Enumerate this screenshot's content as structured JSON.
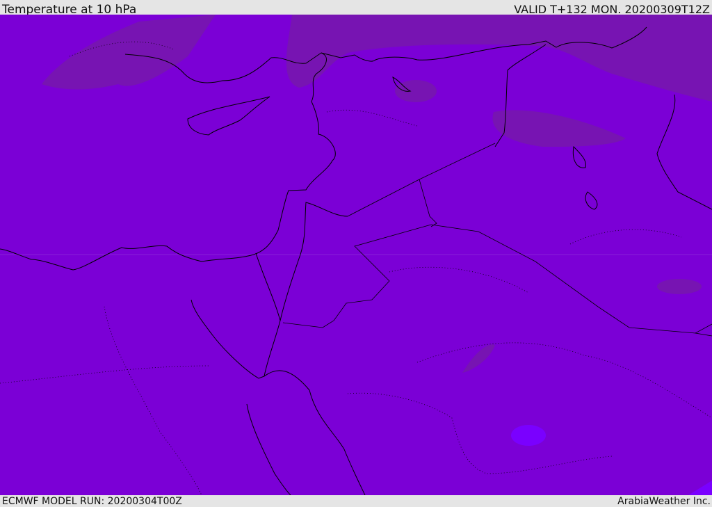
{
  "header": {
    "title": "Temperature at 10 hPa",
    "valid_time": "VALID T+132 MON. 20200309T12Z"
  },
  "footer": {
    "model_run": "ECMWF MODEL RUN: 20200304T00Z",
    "credit": "ArabiaWeather Inc."
  },
  "colors": {
    "base_fill": "#7b00d6",
    "warm_patch": "#7714b2",
    "cool_patch": "#7a00ff",
    "coastline": "#000000"
  }
}
